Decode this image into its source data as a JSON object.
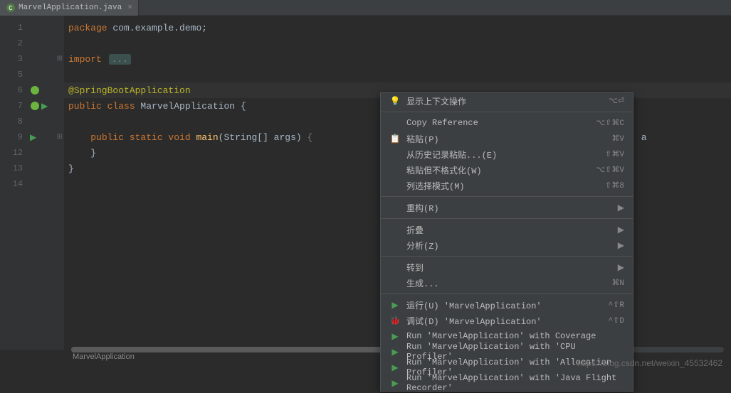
{
  "tab": {
    "filename": "MarvelApplication.java"
  },
  "code": {
    "l1": {
      "kw": "package ",
      "rest": "com.example.demo;"
    },
    "l3": {
      "kw": "import ",
      "fold": "..."
    },
    "l6": {
      "anno": "@SpringBootApplication"
    },
    "l7": {
      "kw1": "public class ",
      "cls": "MarvelApplication {"
    },
    "l9": {
      "indent": "    ",
      "kw1": "public static void ",
      "fn": "main",
      "args": "(String[] args) ",
      "hint": "{",
      "cont": "ation.class, a"
    },
    "l12": {
      "txt": "    }"
    },
    "l13": {
      "txt": "}"
    }
  },
  "lineNums": [
    "1",
    "2",
    "3",
    "5",
    "6",
    "7",
    "8",
    "9",
    "12",
    "13",
    "14"
  ],
  "breadcrumb": "MarvelApplication",
  "menu": {
    "show_context": "显示上下文操作",
    "show_context_sc": "⌥⏎",
    "copy_ref": "Copy Reference",
    "copy_ref_sc": "⌥⇧⌘C",
    "paste": "粘贴(P)",
    "paste_sc": "⌘V",
    "paste_history": "从历史记录粘贴...(E)",
    "paste_history_sc": "⇧⌘V",
    "paste_plain": "粘贴但不格式化(W)",
    "paste_plain_sc": "⌥⇧⌘V",
    "column_select": "列选择模式(M)",
    "column_select_sc": "⇧⌘8",
    "refactor": "重构(R)",
    "fold": "折叠",
    "analyze": "分析(Z)",
    "goto": "转到",
    "generate": "生成...",
    "generate_sc": "⌘N",
    "run": "运行(U) 'MarvelApplication'",
    "run_sc": "^⇧R",
    "debug": "调试(D) 'MarvelApplication'",
    "debug_sc": "^⇧D",
    "run_cov": "Run 'MarvelApplication' with Coverage",
    "run_cpu": "Run 'MarvelApplication' with 'CPU Profiler'",
    "run_alloc": "Run 'MarvelApplication' with 'Allocation Profiler'",
    "run_jfr": "Run 'MarvelApplication' with 'Java Flight Recorder'"
  },
  "watermark": "https://blog.csdn.net/weixin_45532462"
}
